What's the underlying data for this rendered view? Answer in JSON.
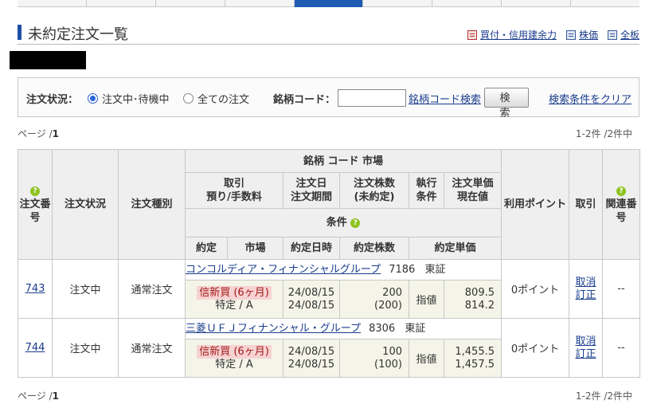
{
  "page": {
    "title": "未約定注文一覧",
    "links": [
      {
        "label": "買付・信用建余力"
      },
      {
        "label": "株価"
      },
      {
        "label": "全板"
      }
    ]
  },
  "filter": {
    "status_label": "注文状況：",
    "radio_active": "注文中･待機中",
    "radio_all": "全ての注文",
    "code_label": "銘柄コード：",
    "code_value": "",
    "code_search_link": "銘柄コード検索",
    "search_button": "検 索",
    "clear_link": "検索条件をクリア"
  },
  "pager": {
    "prefix": "ページ /",
    "page": "1",
    "count": "1-2件 /2件中"
  },
  "table": {
    "headers": {
      "order_no": "注文番号",
      "status": "注文状況",
      "order_type": "注文種別",
      "stock": "銘柄 コード 市場",
      "trade": "取引",
      "custody_fee": "預り/手数料",
      "order_date": "注文日",
      "order_period": "注文期間",
      "order_qty": "注文株数",
      "unfilled": "(未約定)",
      "exec": "執行",
      "cond": "条件",
      "order_price": "注文単価",
      "current_price": "現在値",
      "conditions": "条件",
      "filled": "約定",
      "market": "市場",
      "filled_datetime": "約定日時",
      "filled_qty": "約定株数",
      "filled_price": "約定単価",
      "points": "利用ポイント",
      "trade_action": "取引",
      "related_no": "関連番号"
    },
    "rows": [
      {
        "order_no": "743",
        "status": "注文中",
        "order_type": "通常注文",
        "stock_name": "コンコルディア・フィナンシャルグループ",
        "code": "7186",
        "market": "東証",
        "trade": "信新買 (6ヶ月)",
        "custody": "特定 / A",
        "order_date": "24/08/15",
        "period": "24/08/15",
        "qty": "200",
        "unfilled": "(200)",
        "exec_cond": "指値",
        "order_price": "809.5",
        "current_price": "814.2",
        "points": "0ポイント",
        "cancel": "取消",
        "modify": "訂正",
        "related": "--"
      },
      {
        "order_no": "744",
        "status": "注文中",
        "order_type": "通常注文",
        "stock_name": "三菱ＵＦＪフィナンシャル・グループ",
        "code": "8306",
        "market": "東証",
        "trade": "信新買 (6ヶ月)",
        "custody": "特定 / A",
        "order_date": "24/08/15",
        "period": "24/08/15",
        "qty": "100",
        "unfilled": "(100)",
        "exec_cond": "指値",
        "order_price": "1,455.5",
        "current_price": "1,457.5",
        "points": "0ポイント",
        "cancel": "取消",
        "modify": "訂正",
        "related": "--"
      }
    ]
  },
  "colors": {
    "accent": "#1f5bb5",
    "link": "#1a3c8c",
    "order_type_bg": "#f7d2d2",
    "order_type_text": "#a31818",
    "help_icon": "#8dc21f"
  }
}
